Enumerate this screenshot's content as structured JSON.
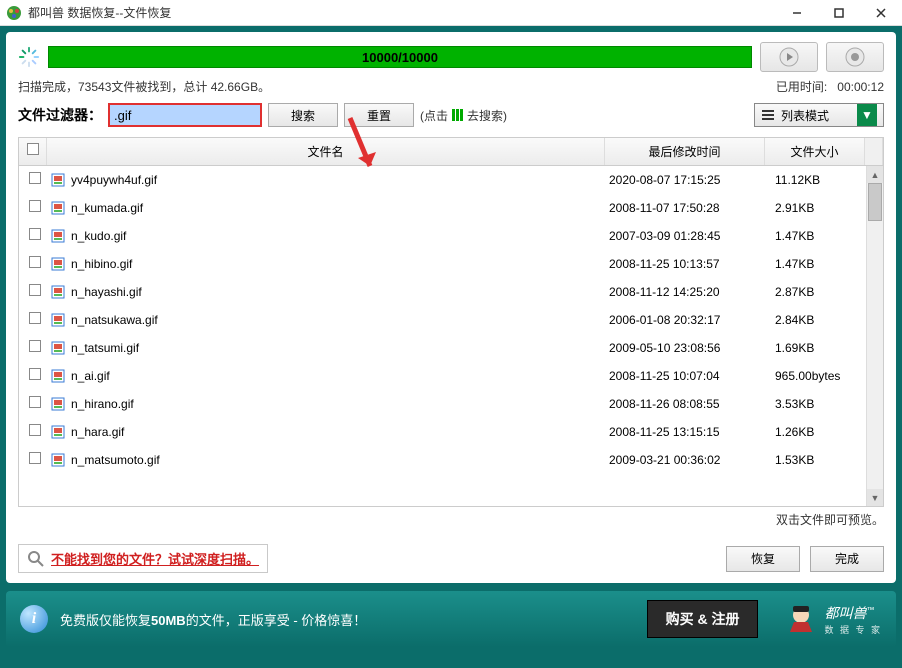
{
  "window": {
    "title": "都叫兽 数据恢复--文件恢复"
  },
  "progress": {
    "text": "10000/10000"
  },
  "status": {
    "left": "扫描完成，73543文件被找到，总计 42.66GB。",
    "right_label": "已用时间:",
    "right_value": "00:00:12"
  },
  "filter": {
    "label": "文件过滤器：",
    "value": ".gif",
    "search_btn": "搜索",
    "reset_btn": "重置",
    "hint_prefix": "(点击",
    "hint_suffix": "去搜索)",
    "viewmode": "列表模式"
  },
  "columns": {
    "name": "文件名",
    "mtime": "最后修改时间",
    "size": "文件大小"
  },
  "rows": [
    {
      "name": "yv4puywh4uf.gif",
      "mtime": "2020-08-07 17:15:25",
      "size": "11.12KB"
    },
    {
      "name": "n_kumada.gif",
      "mtime": "2008-11-07 17:50:28",
      "size": "2.91KB"
    },
    {
      "name": "n_kudo.gif",
      "mtime": "2007-03-09 01:28:45",
      "size": "1.47KB"
    },
    {
      "name": "n_hibino.gif",
      "mtime": "2008-11-25 10:13:57",
      "size": "1.47KB"
    },
    {
      "name": "n_hayashi.gif",
      "mtime": "2008-11-12 14:25:20",
      "size": "2.87KB"
    },
    {
      "name": "n_natsukawa.gif",
      "mtime": "2006-01-08 20:32:17",
      "size": "2.84KB"
    },
    {
      "name": "n_tatsumi.gif",
      "mtime": "2009-05-10 23:08:56",
      "size": "1.69KB"
    },
    {
      "name": "n_ai.gif",
      "mtime": "2008-11-25 10:07:04",
      "size": "965.00bytes"
    },
    {
      "name": "n_hirano.gif",
      "mtime": "2008-11-26 08:08:55",
      "size": "3.53KB"
    },
    {
      "name": "n_hara.gif",
      "mtime": "2008-11-25 13:15:15",
      "size": "1.26KB"
    },
    {
      "name": "n_matsumoto.gif",
      "mtime": "2009-03-21 00:36:02",
      "size": "1.53KB"
    }
  ],
  "preview_hint": "双击文件即可预览。",
  "deepscan": {
    "text": "不能找到您的文件？试试深度扫描。"
  },
  "actions": {
    "recover": "恢复",
    "finish": "完成"
  },
  "bottom": {
    "msg_pre": "免费版仅能恢复",
    "msg_bold": "50MB",
    "msg_post": "的文件，正版享受 - 价格惊喜！",
    "buy": "购买 & 注册",
    "brand_title": "都叫兽",
    "brand_sub": "数 据 专 家",
    "tm": "™"
  }
}
